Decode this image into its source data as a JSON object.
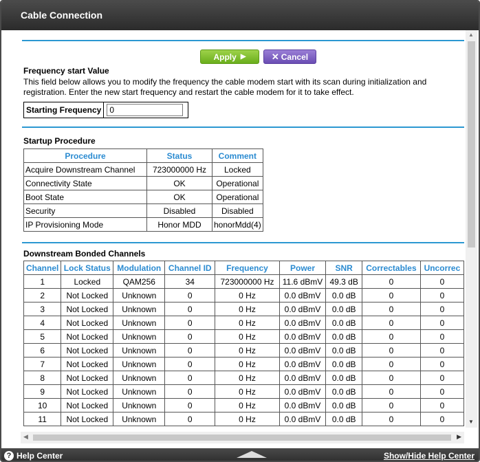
{
  "window": {
    "title": "Cable Connection"
  },
  "buttons": {
    "apply": "Apply",
    "cancel": "Cancel"
  },
  "frequency": {
    "heading": "Frequency start Value",
    "description": "This field below allows you to modify the frequency the cable modem start with its scan during initialization and registration. Enter the new start frequency and restart the cable modem for it to take effect.",
    "label": "Starting Frequency",
    "value": "0"
  },
  "startup": {
    "heading": "Startup Procedure",
    "columns": [
      "Procedure",
      "Status",
      "Comment"
    ],
    "rows": [
      [
        "Acquire Downstream Channel",
        "723000000 Hz",
        "Locked"
      ],
      [
        "Connectivity State",
        "OK",
        "Operational"
      ],
      [
        "Boot State",
        "OK",
        "Operational"
      ],
      [
        "Security",
        "Disabled",
        "Disabled"
      ],
      [
        "IP Provisioning Mode",
        "Honor MDD",
        "honorMdd(4)"
      ]
    ]
  },
  "downstream": {
    "heading": "Downstream Bonded Channels",
    "columns": [
      "Channel",
      "Lock Status",
      "Modulation",
      "Channel ID",
      "Frequency",
      "Power",
      "SNR",
      "Correctables",
      "Uncorrec"
    ],
    "rows": [
      [
        "1",
        "Locked",
        "QAM256",
        "34",
        "723000000 Hz",
        "11.6 dBmV",
        "49.3 dB",
        "0",
        "0"
      ],
      [
        "2",
        "Not Locked",
        "Unknown",
        "0",
        "0 Hz",
        "0.0 dBmV",
        "0.0 dB",
        "0",
        "0"
      ],
      [
        "3",
        "Not Locked",
        "Unknown",
        "0",
        "0 Hz",
        "0.0 dBmV",
        "0.0 dB",
        "0",
        "0"
      ],
      [
        "4",
        "Not Locked",
        "Unknown",
        "0",
        "0 Hz",
        "0.0 dBmV",
        "0.0 dB",
        "0",
        "0"
      ],
      [
        "5",
        "Not Locked",
        "Unknown",
        "0",
        "0 Hz",
        "0.0 dBmV",
        "0.0 dB",
        "0",
        "0"
      ],
      [
        "6",
        "Not Locked",
        "Unknown",
        "0",
        "0 Hz",
        "0.0 dBmV",
        "0.0 dB",
        "0",
        "0"
      ],
      [
        "7",
        "Not Locked",
        "Unknown",
        "0",
        "0 Hz",
        "0.0 dBmV",
        "0.0 dB",
        "0",
        "0"
      ],
      [
        "8",
        "Not Locked",
        "Unknown",
        "0",
        "0 Hz",
        "0.0 dBmV",
        "0.0 dB",
        "0",
        "0"
      ],
      [
        "9",
        "Not Locked",
        "Unknown",
        "0",
        "0 Hz",
        "0.0 dBmV",
        "0.0 dB",
        "0",
        "0"
      ],
      [
        "10",
        "Not Locked",
        "Unknown",
        "0",
        "0 Hz",
        "0.0 dBmV",
        "0.0 dB",
        "0",
        "0"
      ],
      [
        "11",
        "Not Locked",
        "Unknown",
        "0",
        "0 Hz",
        "0.0 dBmV",
        "0.0 dB",
        "0",
        "0"
      ]
    ]
  },
  "footer": {
    "help": "Help Center",
    "toggle": "Show/Hide Help Center"
  },
  "colors": {
    "accent": "#2b98d1",
    "apply": "#7dbf2e",
    "cancel": "#7b5cc4",
    "header": "#333333"
  },
  "icons": {
    "help": "help-circle-icon",
    "apply_arrow": "play-arrow-icon",
    "cancel_x": "close-icon"
  }
}
